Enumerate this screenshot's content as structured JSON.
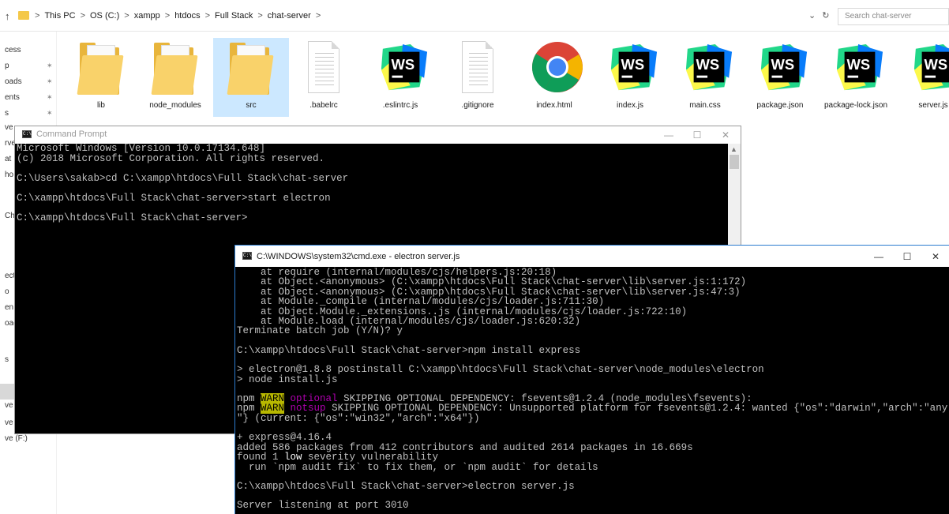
{
  "explorer": {
    "breadcrumb": [
      ">",
      "This PC",
      ">",
      "OS (C:)",
      ">",
      "xampp",
      ">",
      "htdocs",
      ">",
      "Full Stack",
      ">",
      "chat-server",
      ">"
    ],
    "search_placeholder": "Search chat-server",
    "nav_up_icon": "up-arrow-icon",
    "refresh_icon": "refresh-icon",
    "nav_items": [
      {
        "label": "cess",
        "pinned": false
      },
      {
        "label": "p",
        "pinned": true
      },
      {
        "label": "oads",
        "pinned": true
      },
      {
        "label": "ents",
        "pinned": true
      },
      {
        "label": "s",
        "pinned": true
      },
      {
        "label": "ve",
        "pinned": false
      },
      {
        "label": "rve",
        "pinned": false
      },
      {
        "label": "at",
        "pinned": false
      },
      {
        "label": "ho",
        "pinned": false
      },
      {
        "label": "Ch",
        "pinned": false
      },
      {
        "label": "ect",
        "pinned": false
      },
      {
        "label": "o",
        "pinned": false
      },
      {
        "label": "en",
        "pinned": false
      },
      {
        "label": "oac",
        "pinned": false
      },
      {
        "label": "s",
        "pinned": false
      },
      {
        "label": "ve",
        "pinned": false
      },
      {
        "label": "ve",
        "pinned": false
      },
      {
        "label": "ve (F:)",
        "pinned": false
      }
    ],
    "files": [
      {
        "name": "lib",
        "type": "folder"
      },
      {
        "name": "node_modules",
        "type": "folder"
      },
      {
        "name": "src",
        "type": "folder",
        "selected": true
      },
      {
        "name": ".babelrc",
        "type": "doc"
      },
      {
        "name": ".eslintrc.js",
        "type": "webstorm"
      },
      {
        "name": ".gitignore",
        "type": "doc"
      },
      {
        "name": "index.html",
        "type": "chrome"
      },
      {
        "name": "index.js",
        "type": "webstorm"
      },
      {
        "name": "main.css",
        "type": "webstorm"
      },
      {
        "name": "package.json",
        "type": "webstorm"
      },
      {
        "name": "package-lock.json",
        "type": "webstorm"
      },
      {
        "name": "server.js",
        "type": "webstorm"
      }
    ]
  },
  "cmd_window_1": {
    "title": "Command Prompt",
    "lines": [
      "Microsoft Windows [Version 10.0.17134.648]",
      "(c) 2018 Microsoft Corporation. All rights reserved.",
      "",
      "C:\\Users\\sakab>cd C:\\xampp\\htdocs\\Full Stack\\chat-server",
      "",
      "C:\\xampp\\htdocs\\Full Stack\\chat-server>start electron",
      "",
      "C:\\xampp\\htdocs\\Full Stack\\chat-server>"
    ]
  },
  "cmd_window_2": {
    "title": "C:\\WINDOWS\\system32\\cmd.exe - electron  server.js",
    "lines": [
      "    at require (internal/modules/cjs/helpers.js:20:18)",
      "    at Object.<anonymous> (C:\\xampp\\htdocs\\Full Stack\\chat-server\\lib\\server.js:1:172)",
      "    at Object.<anonymous> (C:\\xampp\\htdocs\\Full Stack\\chat-server\\lib\\server.js:47:3)",
      "    at Module._compile (internal/modules/cjs/loader.js:711:30)",
      "    at Object.Module._extensions..js (internal/modules/cjs/loader.js:722:10)",
      "    at Module.load (internal/modules/cjs/loader.js:620:32)",
      "Terminate batch job (Y/N)? y",
      "",
      "C:\\xampp\\htdocs\\Full Stack\\chat-server>npm install express",
      "",
      "> electron@1.8.8 postinstall C:\\xampp\\htdocs\\Full Stack\\chat-server\\node_modules\\electron",
      "> node install.js",
      "",
      "npm WARN optional SKIPPING OPTIONAL DEPENDENCY: fsevents@1.2.4 (node_modules\\fsevents):",
      "npm WARN notsup SKIPPING OPTIONAL DEPENDENCY: Unsupported platform for fsevents@1.2.4: wanted {\"os\":\"darwin\",\"arch\":\"any",
      "\"} (current: {\"os\":\"win32\",\"arch\":\"x64\"})",
      "",
      "+ express@4.16.4",
      "added 586 packages from 412 contributors and audited 2614 packages in 16.669s",
      "found 1 low severity vulnerability",
      "  run `npm audit fix` to fix them, or `npm audit` for details",
      "",
      "C:\\xampp\\htdocs\\Full Stack\\chat-server>electron server.js",
      "",
      "Server listening at port 3010"
    ]
  },
  "colors": {
    "warn_bg": "#b8b800",
    "optional_fg": "#b000b0",
    "console_fg": "#c0c0c0",
    "selected_file_bg": "#cce8ff",
    "active_border": "#2c7ccf"
  }
}
